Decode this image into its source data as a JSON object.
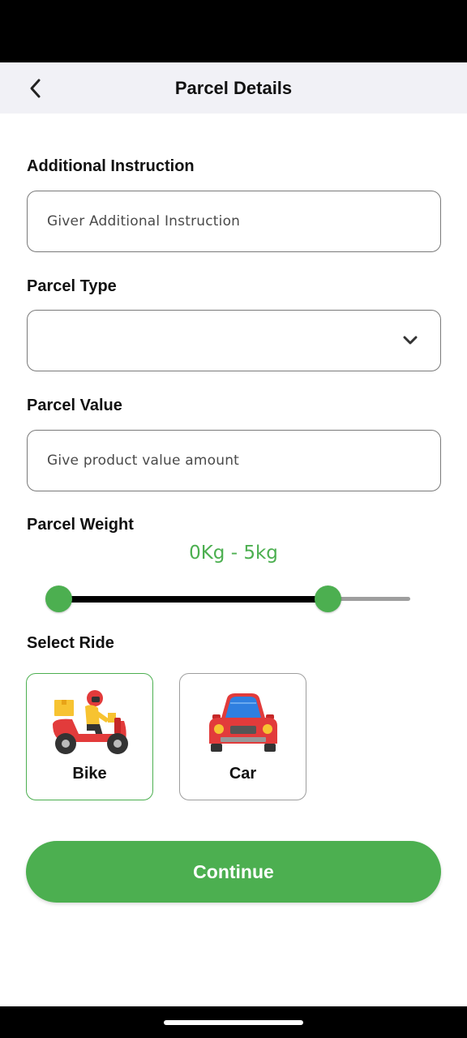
{
  "header": {
    "title": "Parcel Details",
    "back_icon": "chevron-left-icon"
  },
  "additional_instruction": {
    "label": "Additional Instruction",
    "value": "",
    "placeholder": "Giver Additional Instruction"
  },
  "parcel_type": {
    "label": "Parcel Type",
    "selected": "",
    "dropdown_icon": "chevron-down-icon"
  },
  "parcel_value": {
    "label": "Parcel Value",
    "value": "",
    "placeholder": "Give product value amount"
  },
  "parcel_weight": {
    "label": "Parcel Weight",
    "range_text": "0Kg - 5kg",
    "min_value": 0,
    "max_value": 5,
    "scale_max": 6.5
  },
  "select_ride": {
    "label": "Select Ride",
    "options": [
      {
        "label": "Bike",
        "icon": "delivery-scooter-icon",
        "selected": true
      },
      {
        "label": "Car",
        "icon": "car-icon",
        "selected": false
      }
    ]
  },
  "continue_label": "Continue",
  "colors": {
    "accent": "#4caf50",
    "app_bar": "#f1f1f6",
    "border": "#7a7a7a"
  }
}
